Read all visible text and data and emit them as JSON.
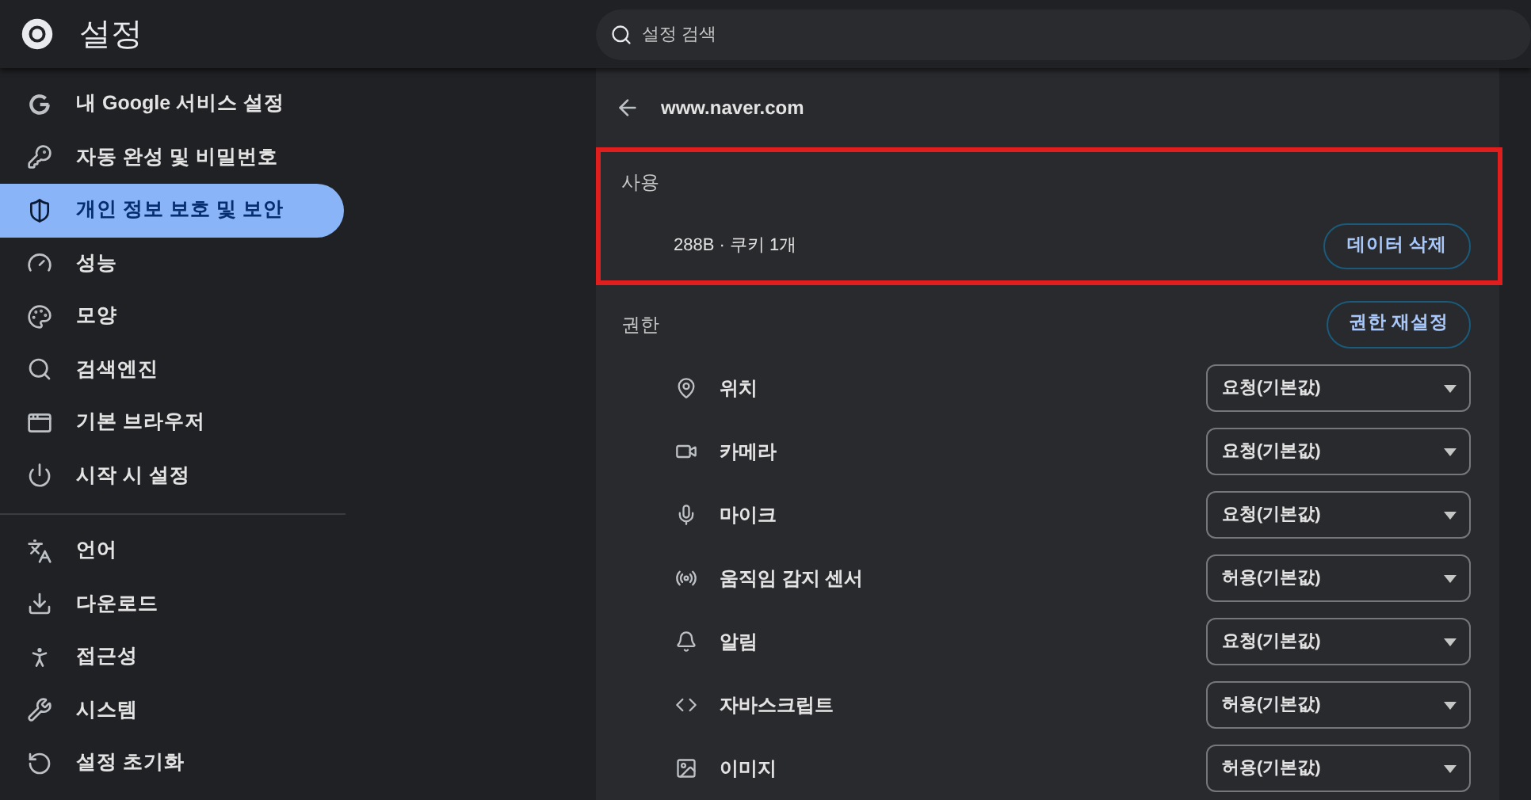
{
  "header": {
    "title": "설정",
    "search": {
      "placeholder": "설정 검색"
    }
  },
  "sidebar": {
    "groups": [
      {
        "items": [
          {
            "label": "내 Google 서비스 설정",
            "selected": false
          },
          {
            "label": "자동 완성 및 비밀번호",
            "selected": false
          },
          {
            "label": "개인 정보 보호 및 보안",
            "selected": true
          },
          {
            "label": "성능",
            "selected": false
          },
          {
            "label": "모양",
            "selected": false
          },
          {
            "label": "검색엔진",
            "selected": false
          },
          {
            "label": "기본 브라우저",
            "selected": false
          },
          {
            "label": "시작 시 설정",
            "selected": false
          }
        ]
      },
      {
        "items": [
          {
            "label": "언어",
            "selected": false
          },
          {
            "label": "다운로드",
            "selected": false
          },
          {
            "label": "접근성",
            "selected": false
          },
          {
            "label": "시스템",
            "selected": false
          },
          {
            "label": "설정 초기화",
            "selected": false
          }
        ]
      }
    ]
  },
  "site": {
    "title": "www.naver.com",
    "usage": {
      "heading": "사용",
      "highlighted": true,
      "summary": "288B · 쿠키 1개",
      "button": "데이터 삭제"
    },
    "permissions": {
      "heading": "권한",
      "button": "권한 재설정",
      "rows": [
        {
          "label": "위치",
          "value": "요청(기본값)"
        },
        {
          "label": "카메라",
          "value": "요청(기본값)"
        },
        {
          "label": "마이크",
          "value": "요청(기본값)"
        },
        {
          "label": "움직임 감지 센서",
          "value": "허용(기본값)"
        },
        {
          "label": "알림",
          "value": "요청(기본값)"
        },
        {
          "label": "자바스크립트",
          "value": "허용(기본값)"
        },
        {
          "label": "이미지",
          "value": "허용(기본값)"
        }
      ]
    }
  }
}
